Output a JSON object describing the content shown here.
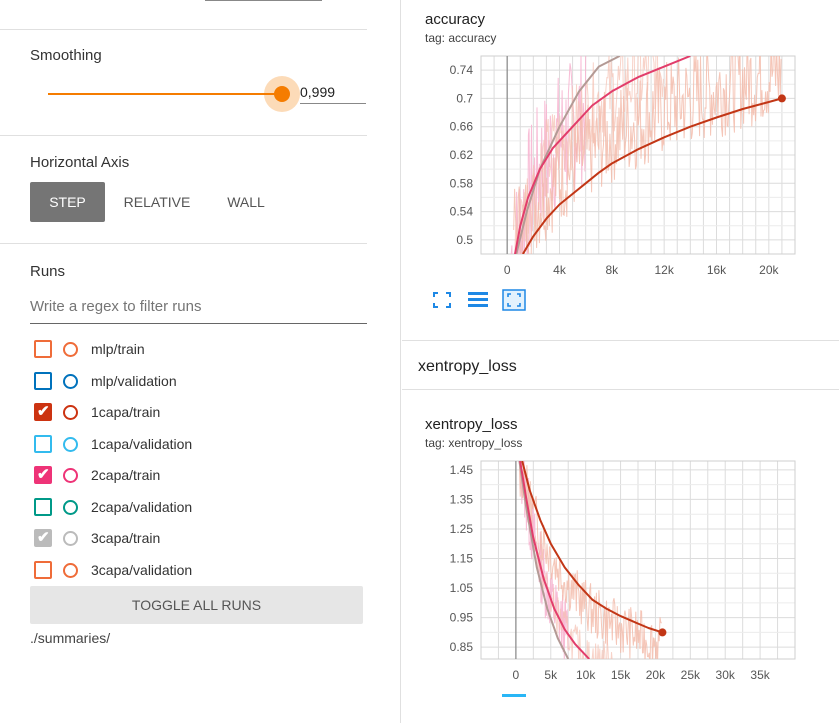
{
  "sidebar": {
    "smoothing": {
      "title": "Smoothing",
      "value": "0,999",
      "fraction": 0.999
    },
    "horizontal_axis": {
      "title": "Horizontal Axis",
      "options": [
        "STEP",
        "RELATIVE",
        "WALL"
      ],
      "selected": "STEP"
    },
    "runs": {
      "title": "Runs",
      "filter_placeholder": "Write a regex to filter runs",
      "items": [
        {
          "label": "mlp/train",
          "checked": false,
          "color": "#ef6c39"
        },
        {
          "label": "mlp/validation",
          "checked": false,
          "color": "#0072bc"
        },
        {
          "label": "1capa/train",
          "checked": true,
          "color": "#cc3311"
        },
        {
          "label": "1capa/validation",
          "checked": false,
          "color": "#33bbee"
        },
        {
          "label": "2capa/train",
          "checked": true,
          "color": "#ee3377"
        },
        {
          "label": "2capa/validation",
          "checked": false,
          "color": "#009988"
        },
        {
          "label": "3capa/train",
          "checked": true,
          "color": "#bbbbbb"
        },
        {
          "label": "3capa/validation",
          "checked": false,
          "color": "#ef6c39"
        }
      ],
      "toggle_all_label": "TOGGLE ALL RUNS",
      "logdir": "./summaries/"
    }
  },
  "main": {
    "accuracy_card": {
      "title": "accuracy",
      "tag": "tag: accuracy"
    },
    "group_title": "xentropy_loss",
    "xentropy_card": {
      "title": "xentropy_loss",
      "tag": "tag: xentropy_loss"
    },
    "icons": [
      "fullscreen-icon",
      "data-selection-icon",
      "fit-domain-icon"
    ]
  },
  "chart_data": [
    {
      "type": "line",
      "title": "accuracy",
      "xlim": [
        -2000,
        22000
      ],
      "ylim": [
        0.48,
        0.76
      ],
      "x_ticks": [
        0,
        4000,
        8000,
        12000,
        16000,
        20000
      ],
      "x_tick_labels": [
        "0",
        "4k",
        "8k",
        "12k",
        "16k",
        "20k"
      ],
      "y_ticks": [
        0.5,
        0.54,
        0.58,
        0.62,
        0.66,
        0.7,
        0.74
      ],
      "y_tick_labels": [
        "0.5",
        "0.54",
        "0.58",
        "0.62",
        "0.66",
        "0.7",
        "0.74"
      ],
      "grid": true,
      "series": [
        {
          "name": "3capa/train",
          "color": "#b39a95",
          "x": [
            700,
            1500,
            2500,
            4000,
            5500,
            7000,
            8600
          ],
          "y": [
            0.48,
            0.54,
            0.6,
            0.66,
            0.71,
            0.745,
            0.76
          ]
        },
        {
          "name": "2capa/train",
          "color": "#e23d6b",
          "x": [
            600,
            1000,
            1600,
            2500,
            3500,
            5000,
            6500,
            8000,
            10000,
            12000,
            14000
          ],
          "y": [
            0.48,
            0.52,
            0.56,
            0.6,
            0.63,
            0.66,
            0.69,
            0.71,
            0.73,
            0.745,
            0.76
          ]
        },
        {
          "name": "1capa/train",
          "color": "#c23616",
          "x": [
            1200,
            2000,
            3000,
            4000,
            5000,
            6000,
            7000,
            8000,
            10000,
            12000,
            14000,
            16000,
            18000,
            20000,
            21000
          ],
          "y": [
            0.48,
            0.505,
            0.53,
            0.55,
            0.565,
            0.58,
            0.595,
            0.608,
            0.628,
            0.645,
            0.66,
            0.673,
            0.685,
            0.695,
            0.7
          ]
        }
      ]
    },
    {
      "type": "line",
      "title": "xentropy_loss",
      "xlim": [
        -5000,
        40000
      ],
      "ylim": [
        0.81,
        1.48
      ],
      "x_ticks": [
        0,
        5000,
        10000,
        15000,
        20000,
        25000,
        30000,
        35000
      ],
      "x_tick_labels": [
        "0",
        "5k",
        "10k",
        "15k",
        "20k",
        "25k",
        "30k",
        "35k"
      ],
      "y_ticks": [
        0.85,
        0.95,
        1.05,
        1.15,
        1.25,
        1.35,
        1.45
      ],
      "y_tick_labels": [
        "0.85",
        "0.95",
        "1.05",
        "1.15",
        "1.25",
        "1.35",
        "1.45"
      ],
      "grid": true,
      "series": [
        {
          "name": "3capa/train",
          "color": "#b39a95",
          "x": [
            500,
            1500,
            3000,
            4500,
            6000,
            7500
          ],
          "y": [
            1.48,
            1.32,
            1.12,
            0.98,
            0.88,
            0.81
          ]
        },
        {
          "name": "2capa/train",
          "color": "#e23d6b",
          "x": [
            600,
            1500,
            2500,
            4000,
            5500,
            7000,
            8500,
            10500
          ],
          "y": [
            1.48,
            1.35,
            1.22,
            1.08,
            0.98,
            0.91,
            0.86,
            0.81
          ]
        },
        {
          "name": "1capa/train",
          "color": "#c23616",
          "x": [
            900,
            2000,
            3500,
            5000,
            7000,
            9000,
            11000,
            13000,
            15000,
            17000,
            19000,
            21000
          ],
          "y": [
            1.48,
            1.38,
            1.28,
            1.2,
            1.12,
            1.06,
            1.01,
            0.98,
            0.955,
            0.935,
            0.915,
            0.9
          ]
        }
      ]
    }
  ]
}
